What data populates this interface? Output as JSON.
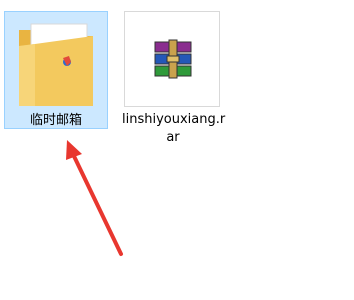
{
  "desktop": {
    "items": [
      {
        "label": "临时邮箱",
        "icon": "folder-icon",
        "selected": true
      },
      {
        "label_line1": "linshiyouxiang.r",
        "label_line2": "ar",
        "icon": "winrar-archive-icon",
        "selected": false
      }
    ]
  },
  "annotation": {
    "icon": "red-arrow-annotation",
    "color": "#e8372f"
  },
  "colors": {
    "selection_bg": "#cce8ff",
    "selection_border": "#99d1ff",
    "folder": "#f3c95e"
  }
}
